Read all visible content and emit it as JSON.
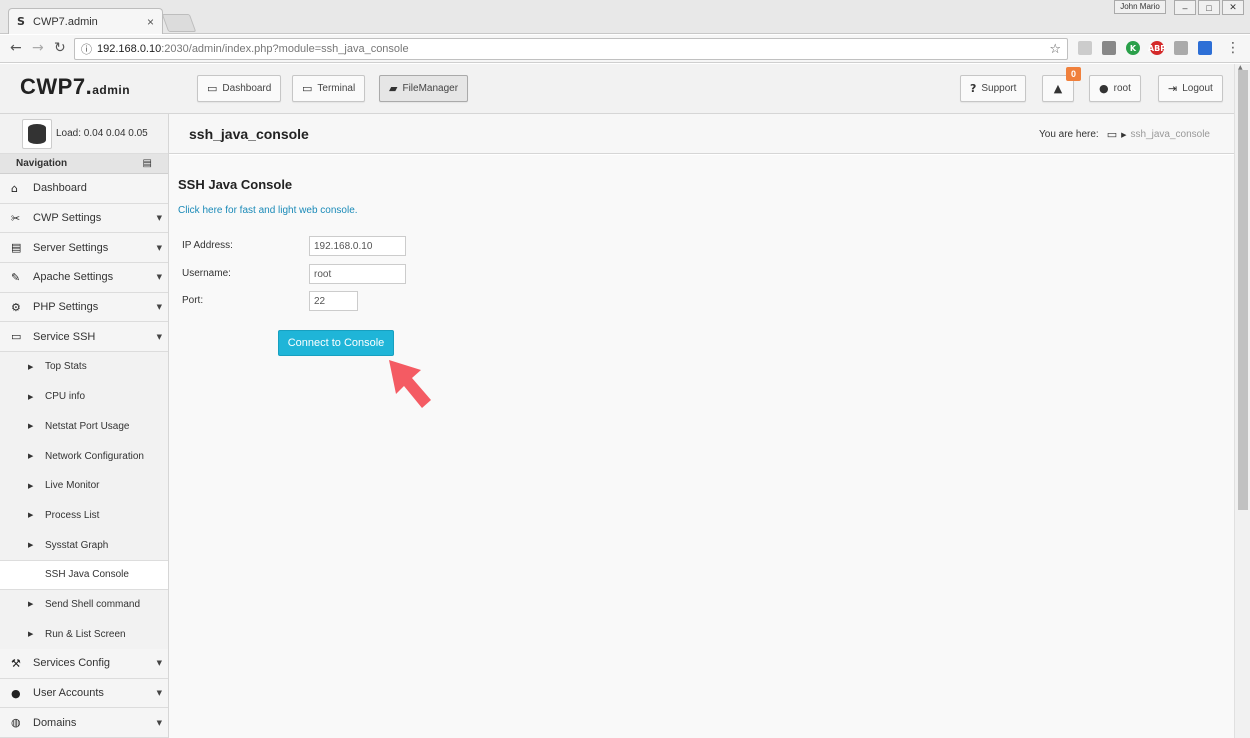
{
  "browser": {
    "tab_title": "CWP7.admin",
    "tab_favicon": "S",
    "tab_close": "×",
    "window_user": "John Mario",
    "url_host": "192.168.0.10",
    "url_path": ":2030/admin/index.php?module=ssh_java_console",
    "icons": [
      "back-arrow-icon",
      "forward-arrow-icon",
      "reload-icon",
      "info-icon",
      "star-icon"
    ]
  },
  "header": {
    "logo_main": "CWP7",
    "logo_sub": "admin",
    "dashboard_label": "Dashboard",
    "terminal_label": "Terminal",
    "filemanager_label": "FileManager",
    "support_label": "Support",
    "notification_count": "0",
    "user_label": "root",
    "logout_label": "Logout"
  },
  "sidebar": {
    "load_text": "Load: 0.04  0.04  0.05",
    "nav_title": "Navigation",
    "items_top": [
      {
        "label": "Dashboard",
        "icon": "home-icon",
        "caret": false
      },
      {
        "label": "CWP Settings",
        "icon": "tools-icon",
        "caret": true
      },
      {
        "label": "Server Settings",
        "icon": "server-icon",
        "caret": true
      },
      {
        "label": "Apache Settings",
        "icon": "feather-icon",
        "caret": true
      },
      {
        "label": "PHP Settings",
        "icon": "gear-icon",
        "caret": true
      },
      {
        "label": "Service SSH",
        "icon": "monitor-icon",
        "caret": true
      }
    ],
    "sub_items": [
      {
        "label": "Top Stats",
        "active": false
      },
      {
        "label": "CPU info",
        "active": false
      },
      {
        "label": "Netstat Port Usage",
        "active": false
      },
      {
        "label": "Network Configuration",
        "active": false
      },
      {
        "label": "Live Monitor",
        "active": false
      },
      {
        "label": "Process List",
        "active": false
      },
      {
        "label": "Sysstat Graph",
        "active": false
      },
      {
        "label": "SSH Java Console",
        "active": true
      },
      {
        "label": "Send Shell command",
        "active": false
      },
      {
        "label": "Run & List Screen",
        "active": false
      }
    ],
    "items_bottom": [
      {
        "label": "Services Config",
        "icon": "wrench-icon",
        "caret": true
      },
      {
        "label": "User Accounts",
        "icon": "user-icon",
        "caret": true
      },
      {
        "label": "Domains",
        "icon": "globe-icon",
        "caret": true
      }
    ]
  },
  "page": {
    "title": "ssh_java_console",
    "breadcrumb_prefix": "You are here:",
    "breadcrumb_current": "ssh_java_console"
  },
  "main": {
    "section_title": "SSH Java Console",
    "web_console_link": "Click here for fast and light web console.",
    "ip_label": "IP Address:",
    "ip_value": "192.168.0.10",
    "username_label": "Username:",
    "username_value": "root",
    "port_label": "Port:",
    "port_value": "22",
    "connect_label": "Connect to Console"
  },
  "colors": {
    "accent": "#1fb5d8",
    "link": "#1a8ab8",
    "badge": "#f0803c",
    "annotation_arrow": "#f45b63"
  }
}
